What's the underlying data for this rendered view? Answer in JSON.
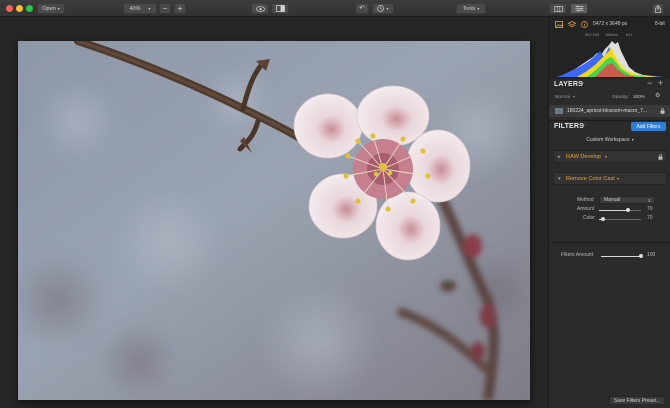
{
  "toolbar": {
    "open_label": "Open",
    "zoom_value": "40%",
    "tools_label": "Tools"
  },
  "image_info": {
    "dimensions": "5472 x 3648 px",
    "bit_depth": "8-bit",
    "iso": "ISO 100",
    "focal": "100mm",
    "aperture": "f/11"
  },
  "layers": {
    "title": "LAYERS",
    "blend_mode": "Normal",
    "opacity_label": "Opacity:",
    "opacity_value": "100%",
    "layer_name": "180224_apricot-blossom-macro_7..."
  },
  "filters": {
    "title": "FILTERS",
    "add_label": "Add Filters",
    "workspace": "Custom Workspace",
    "raw_develop": "RAW Develop",
    "remove_color_cast": "Remove Color Cast",
    "method_label": "Method",
    "method_value": "Manual",
    "amount_label": "Amount",
    "amount_value": "70",
    "amount_fraction": 0.7,
    "color_label": "Color",
    "color_value": "70",
    "color_fraction": 0.1,
    "filters_amount_label": "Filters Amount",
    "filters_amount_value": "100",
    "filters_amount_fraction": 1.0,
    "save_preset_label": "Save Filters Preset..."
  },
  "colors": {
    "accent_blue": "#2f7fd6",
    "filter_orange": "#e5a43a"
  }
}
